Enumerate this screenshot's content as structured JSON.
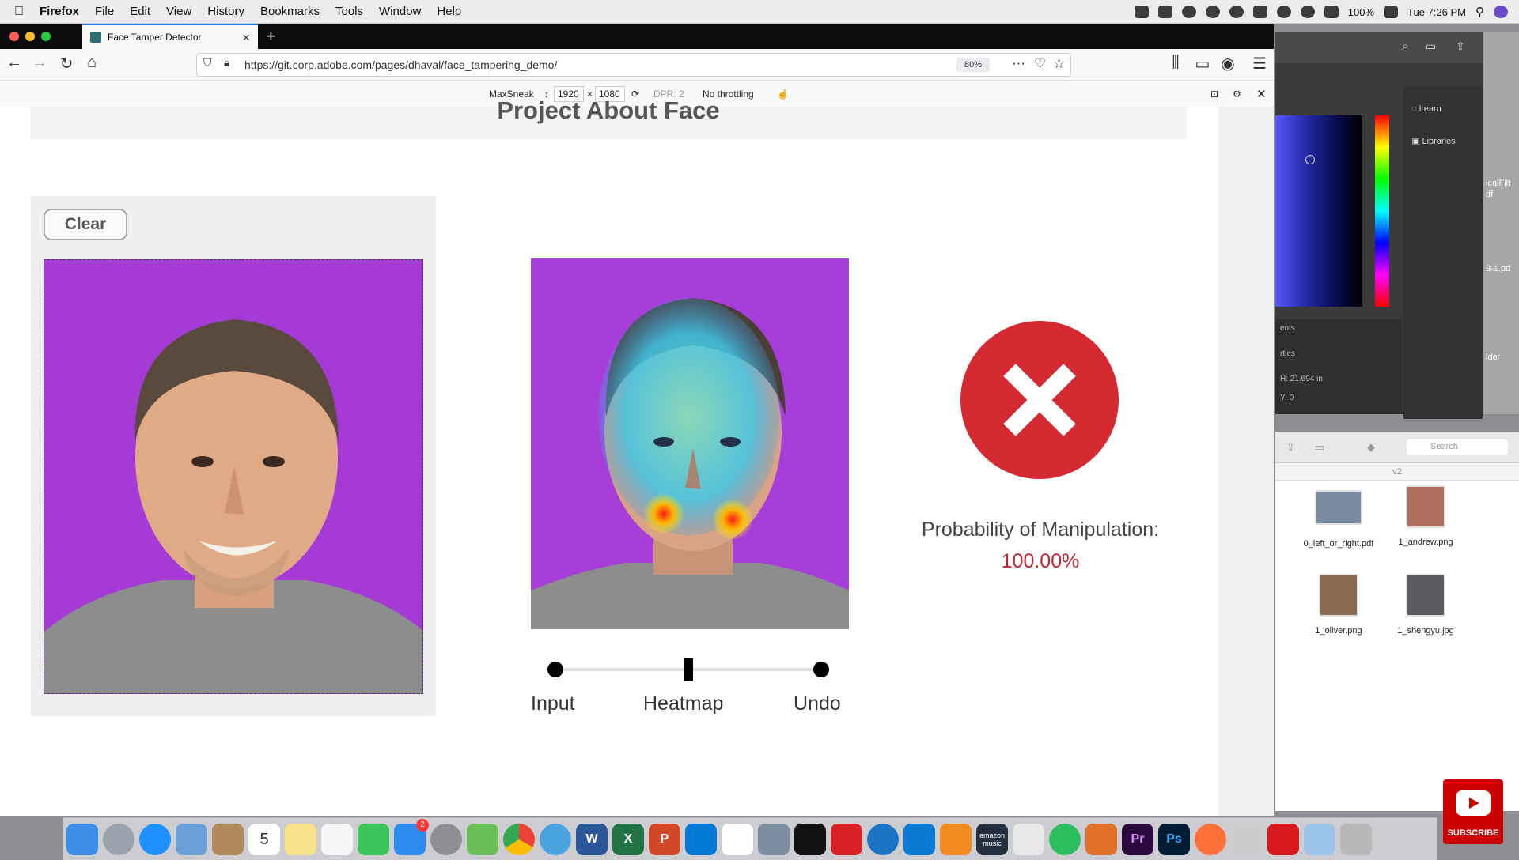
{
  "menubar": {
    "items": [
      "Firefox",
      "File",
      "Edit",
      "View",
      "History",
      "Bookmarks",
      "Tools",
      "Window",
      "Help"
    ],
    "battery": "100%",
    "clock": "Tue 7:26 PM"
  },
  "browser": {
    "tab_title": "Face Tamper Detector",
    "url": "https://git.corp.adobe.com/pages/dhaval/face_tampering_demo/",
    "zoom": "80%"
  },
  "rdm": {
    "device": "MaxSneak",
    "width": "1920",
    "x": "×",
    "height": "1080",
    "dpr": "DPR: 2",
    "throttling": "No throttling"
  },
  "page": {
    "heading": "Project About Face",
    "clear_label": "Clear",
    "slider": {
      "labels": [
        "Input",
        "Heatmap",
        "Undo"
      ],
      "position": 0.5
    },
    "result": {
      "label": "Probability of Manipulation:",
      "value": "100.00%"
    }
  },
  "photoshop": {
    "learn": "Learn",
    "libraries": "Libraries",
    "panel_a": "ents",
    "panel_b": "rties",
    "prop_h": "H: 21.694 in",
    "prop_y": "Y: 0",
    "side_a": "icalFilt",
    "side_b": "df",
    "side_c": "9-1.pd",
    "side_d": "lder"
  },
  "finder": {
    "search_placeholder": "Search",
    "path": "v2",
    "files": [
      "0_left_or_right.pdf",
      "1_andrew.png",
      "1_oliver.png",
      "1_shengyu.jpg"
    ]
  },
  "dock": {
    "calendar_day": "5",
    "appstore_badge": "2",
    "word": "W",
    "excel": "X",
    "powerpoint": "P",
    "amazon_music": "amazon music",
    "premiere": "Pr",
    "photoshop": "Ps"
  },
  "youtube": {
    "label": "SUBSCRIBE"
  },
  "colors": {
    "accent": "#0a84ff",
    "manipulation_red": "#d62a33",
    "photo_bg": "#a63ad6"
  }
}
